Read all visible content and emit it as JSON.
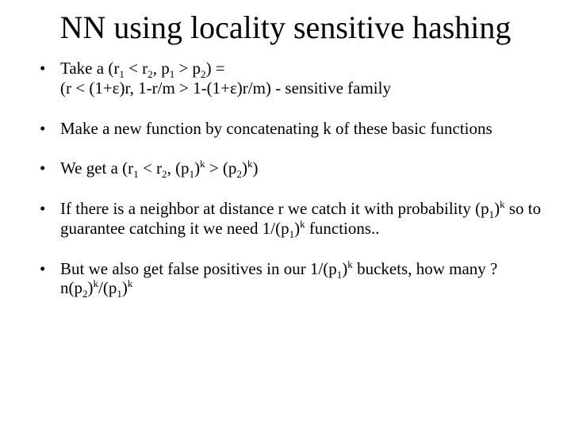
{
  "title": "NN using locality sensitive hashing",
  "bullets": [
    {
      "line1_a": "Take a (r",
      "line1_b": " < r",
      "line1_c": ", p",
      "line1_d": " > p",
      "line1_e": ") =",
      "line2_a": "(r < (1+ε)r, 1-r/m > 1-(1+ε)r/m) - sensitive family"
    },
    {
      "text": "Make a new function by concatenating k of these basic functions"
    },
    {
      "a": "We get a (r",
      "b": " < r",
      "c": ", (p",
      "d": ")",
      "e": " > (p",
      "f": ")",
      "g": ")"
    },
    {
      "a": "If there is a neighbor at distance r we catch it with probability (p",
      "b": ")",
      "c": " so to guarantee catching it we need 1/(p",
      "d": ")",
      "e": " functions.."
    },
    {
      "a": "But we also get false positives in our 1/(p",
      "b": ")",
      "c": " buckets, how many ?  n(p",
      "d": ")",
      "e": "/(p",
      "f": ")"
    }
  ],
  "sub": {
    "one": "1",
    "two": "2"
  },
  "sup": {
    "k": "k"
  }
}
